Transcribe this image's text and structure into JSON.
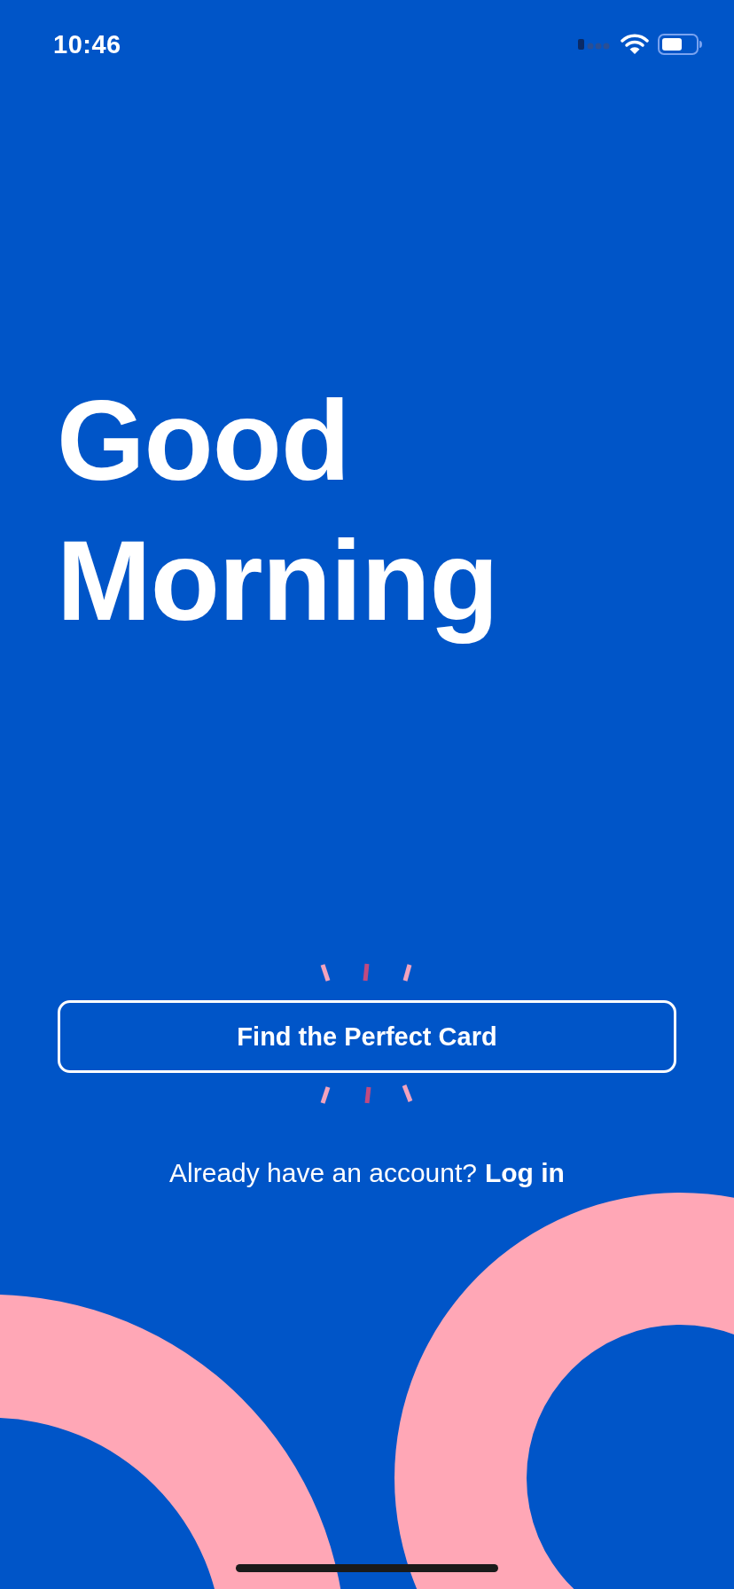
{
  "status_bar": {
    "time": "10:46"
  },
  "greeting": "Good Morning",
  "primary_button": {
    "label": "Find the Perfect Card"
  },
  "login_prompt": {
    "text": "Already have an account?",
    "link": "Log in"
  }
}
